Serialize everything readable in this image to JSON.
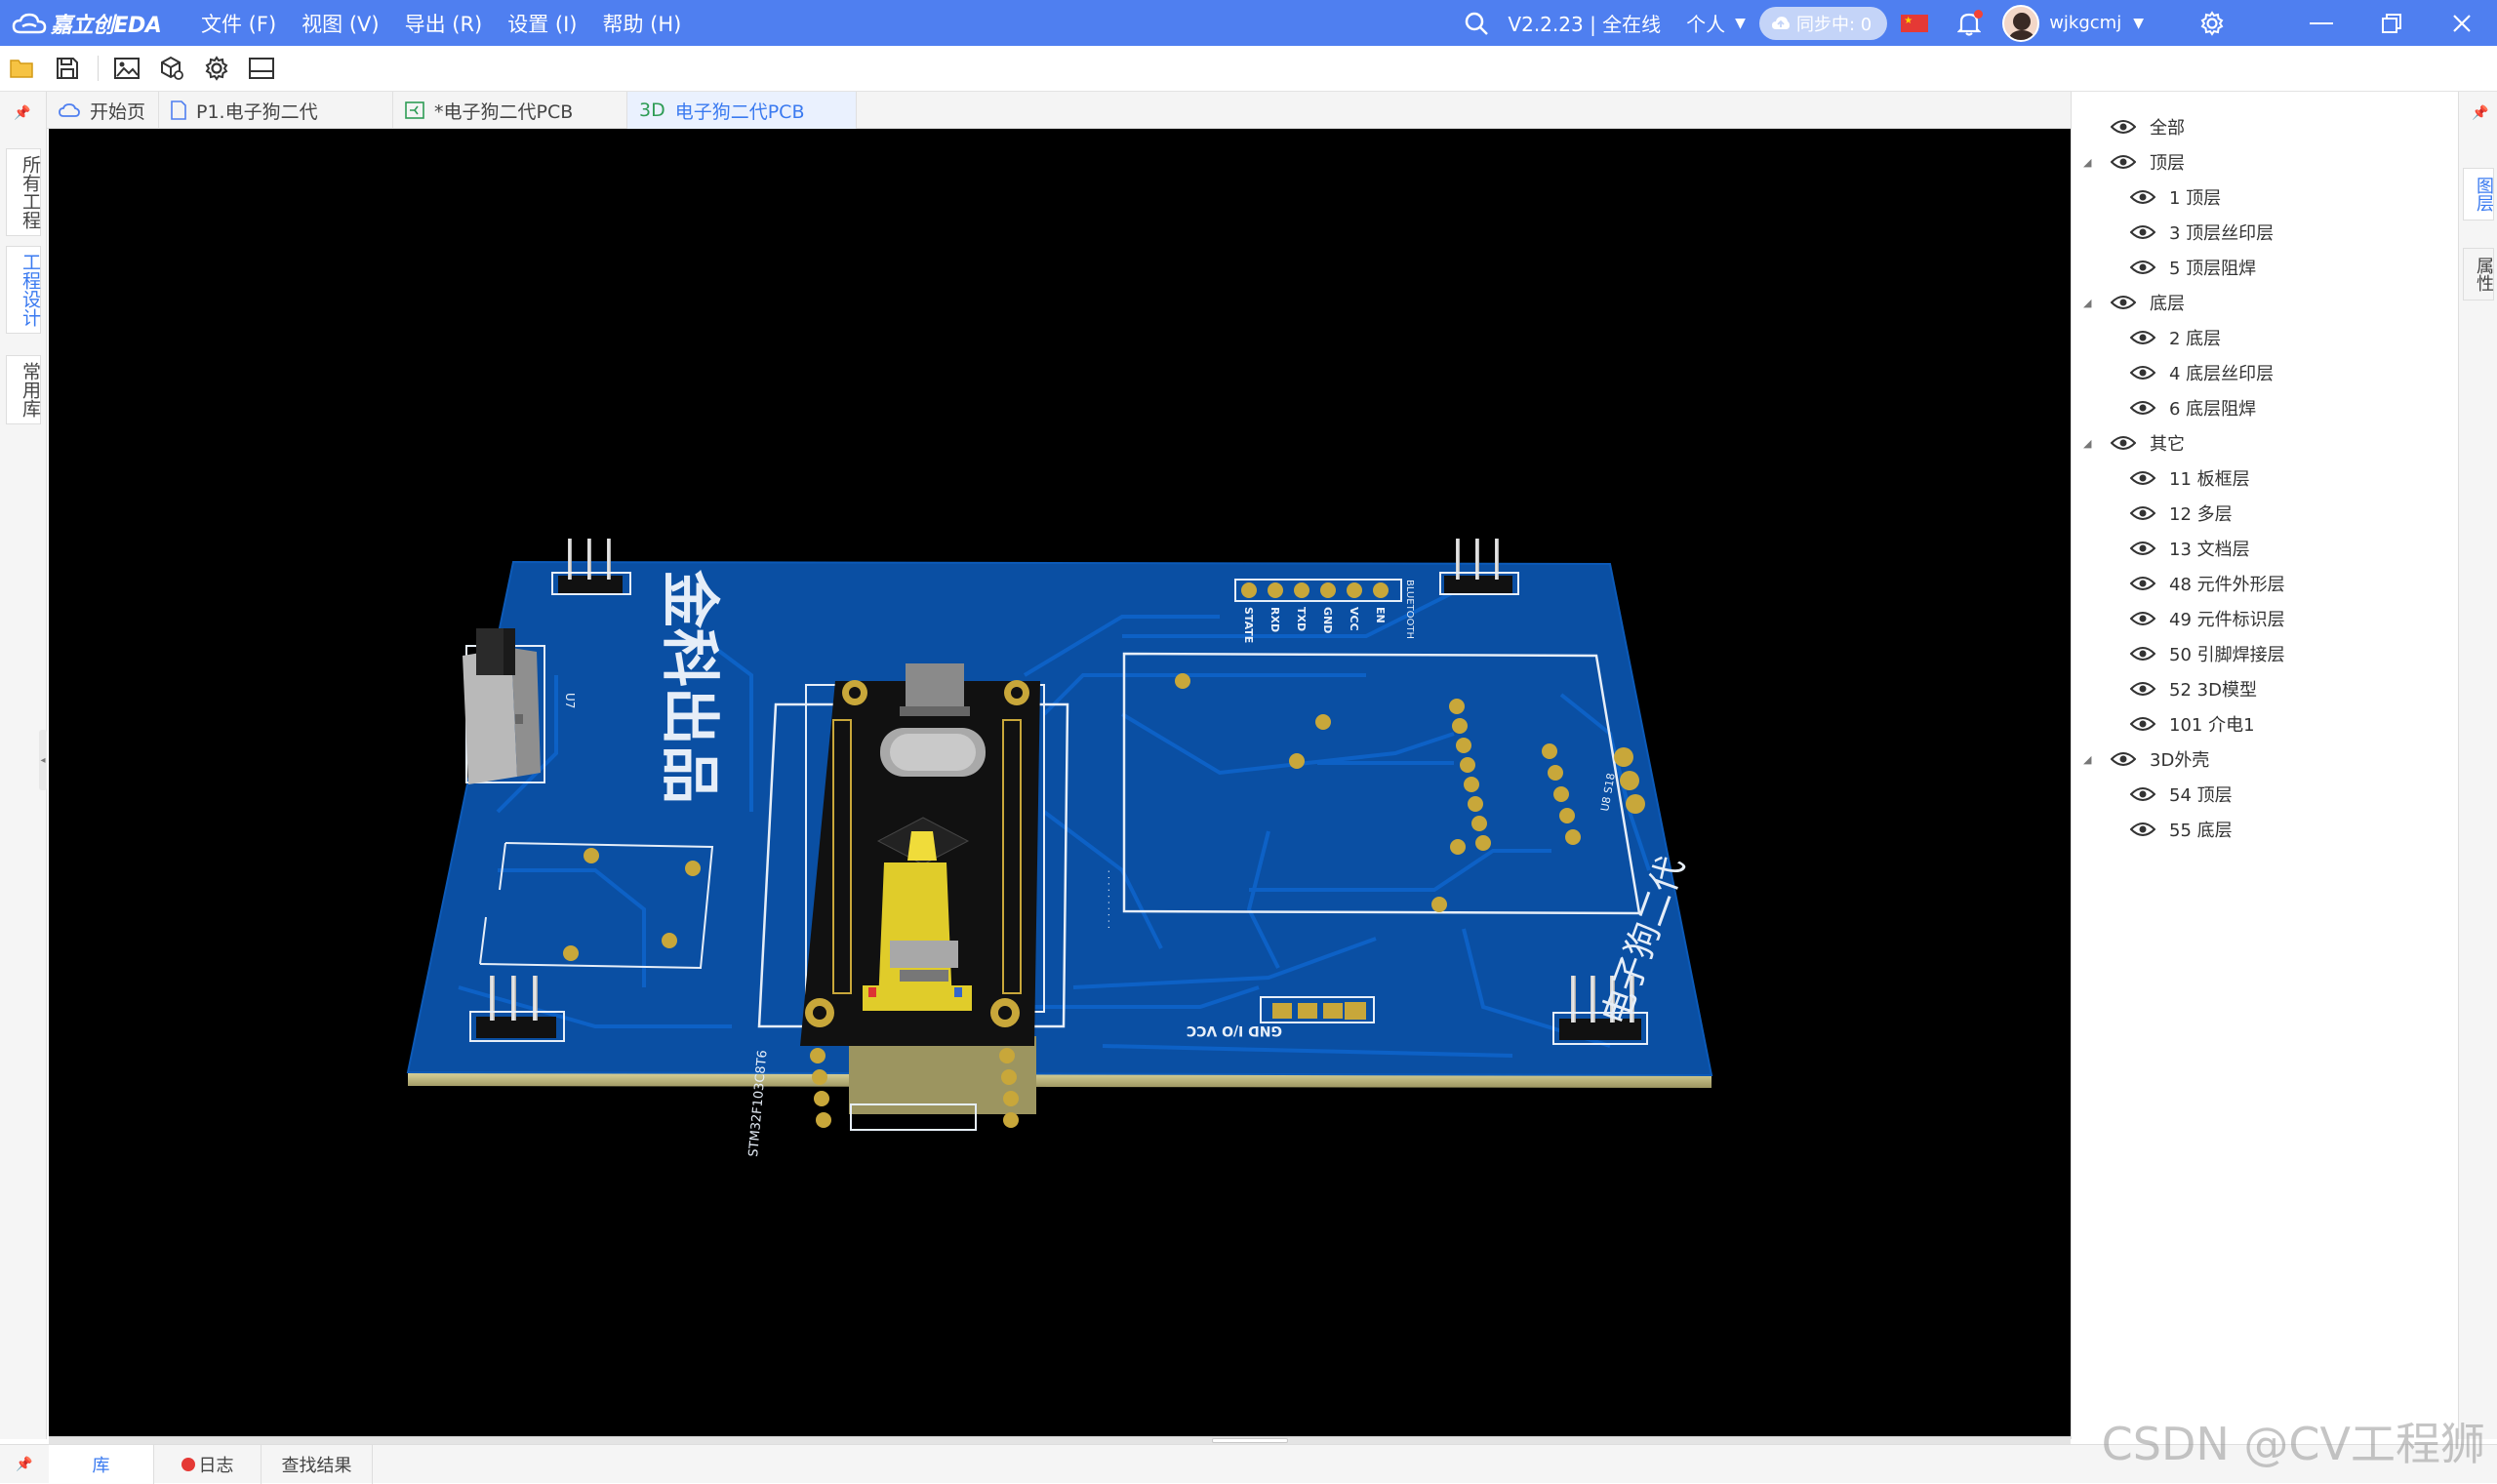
{
  "app": {
    "logo_text": "嘉立创EDA",
    "menus": [
      "文件 (F)",
      "视图 (V)",
      "导出 (R)",
      "设置 (I)",
      "帮助 (H)"
    ],
    "version_status": "V2.2.23 | 全在线",
    "personal_label": "个人",
    "sync_label": "同步中: 0",
    "username": "wjkgcmj"
  },
  "tabs": [
    {
      "label": "开始页",
      "icon": "cloud-icon"
    },
    {
      "label": "P1.电子狗二代",
      "icon": "schematic-doc-icon"
    },
    {
      "label": "*电子狗二代PCB",
      "icon": "pcb-doc-icon"
    },
    {
      "label": "电子狗二代PCB",
      "prefix": "3D",
      "active": true
    }
  ],
  "left_tabs": [
    "所有工程",
    "工程设计",
    "常用库"
  ],
  "right_tabs": [
    "图层",
    "属性"
  ],
  "layers": [
    {
      "label": "全部",
      "level": 0,
      "group": false
    },
    {
      "label": "顶层",
      "level": 0,
      "group": true
    },
    {
      "label": "1 顶层",
      "level": 1
    },
    {
      "label": "3 顶层丝印层",
      "level": 1
    },
    {
      "label": "5 顶层阻焊",
      "level": 1
    },
    {
      "label": "底层",
      "level": 0,
      "group": true
    },
    {
      "label": "2 底层",
      "level": 1
    },
    {
      "label": "4 底层丝印层",
      "level": 1
    },
    {
      "label": "6 底层阻焊",
      "level": 1
    },
    {
      "label": "其它",
      "level": 0,
      "group": true
    },
    {
      "label": "11 板框层",
      "level": 1
    },
    {
      "label": "12 多层",
      "level": 1
    },
    {
      "label": "13 文档层",
      "level": 1
    },
    {
      "label": "48 元件外形层",
      "level": 1
    },
    {
      "label": "49 元件标识层",
      "level": 1
    },
    {
      "label": "50 引脚焊接层",
      "level": 1
    },
    {
      "label": "52 3D模型",
      "level": 1
    },
    {
      "label": "101 介电1",
      "level": 1
    },
    {
      "label": "3D外壳",
      "level": 0,
      "group": true
    },
    {
      "label": "54 顶层",
      "level": 1
    },
    {
      "label": "55 底层",
      "level": 1
    }
  ],
  "bottom_tabs": [
    "库",
    "日志",
    "查找结果"
  ],
  "pcb": {
    "silk_title": "金科出品",
    "silk_product": "电子狗二代",
    "silk_mcu": "STM32F103C8T6",
    "silk_power": "GND I/O VCC",
    "silk_bt": "BLUETOOTH",
    "silk_bt_pins": [
      "STATE",
      "RXD",
      "TXD",
      "GND",
      "VCC",
      "EN"
    ],
    "silk_u7": "U7",
    "silk_right_small": "U8 S18",
    "colors": {
      "board": "#0a4fa3",
      "trace": "#0e5fc0",
      "silk": "#e6eef8",
      "pad": "#c8a73a",
      "module": "#111111"
    }
  },
  "watermark": "CSDN @CV工程狮"
}
